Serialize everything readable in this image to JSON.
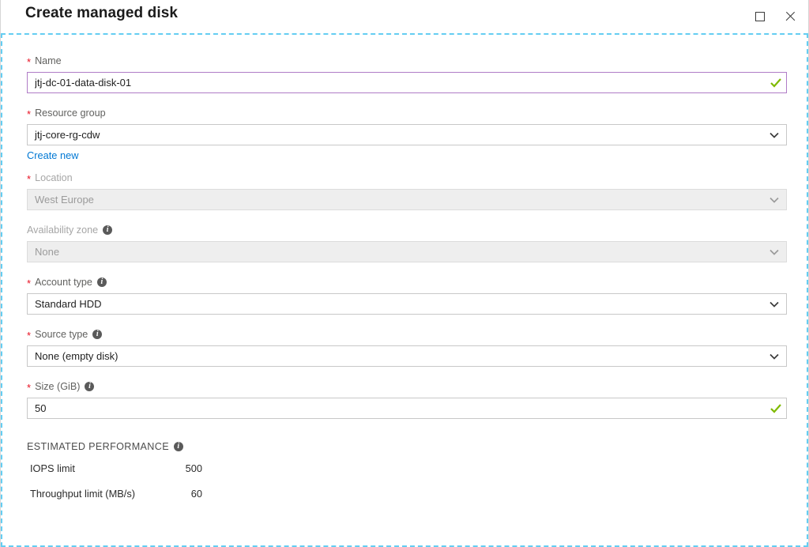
{
  "header": {
    "title": "Create managed disk",
    "maximize_icon": "maximize-icon",
    "close_icon": "close-icon"
  },
  "form": {
    "name": {
      "label": "Name",
      "required": true,
      "value": "jtj-dc-01-data-disk-01",
      "state": "valid-focused",
      "validation_icon": "check-icon"
    },
    "resource_group": {
      "label": "Resource group",
      "required": true,
      "value": "jtj-core-rg-cdw",
      "create_new_link": "Create new",
      "dropdown_icon": "chevron-down-icon"
    },
    "location": {
      "label": "Location",
      "required": true,
      "value": "West Europe",
      "disabled": true,
      "dropdown_icon": "chevron-down-icon"
    },
    "availability_zone": {
      "label": "Availability zone",
      "required": false,
      "value": "None",
      "disabled": true,
      "info_icon": "info-icon",
      "dropdown_icon": "chevron-down-icon"
    },
    "account_type": {
      "label": "Account type",
      "required": true,
      "value": "Standard HDD",
      "info_icon": "info-icon",
      "dropdown_icon": "chevron-down-icon"
    },
    "source_type": {
      "label": "Source type",
      "required": true,
      "value": "None (empty disk)",
      "info_icon": "info-icon",
      "dropdown_icon": "chevron-down-icon"
    },
    "size": {
      "label": "Size (GiB)",
      "required": true,
      "value": "50",
      "info_icon": "info-icon",
      "validation_icon": "check-icon"
    }
  },
  "estimated_performance": {
    "title": "ESTIMATED PERFORMANCE",
    "info_icon": "info-icon",
    "rows": [
      {
        "name": "IOPS limit",
        "value": "500"
      },
      {
        "name": "Throughput limit (MB/s)",
        "value": "60"
      }
    ]
  },
  "colors": {
    "accent_link": "#0078d4",
    "required_star": "#e81123",
    "valid_check": "#7fba00",
    "focus_border": "#b07cc6",
    "focus_outline": "#64cdf2"
  }
}
